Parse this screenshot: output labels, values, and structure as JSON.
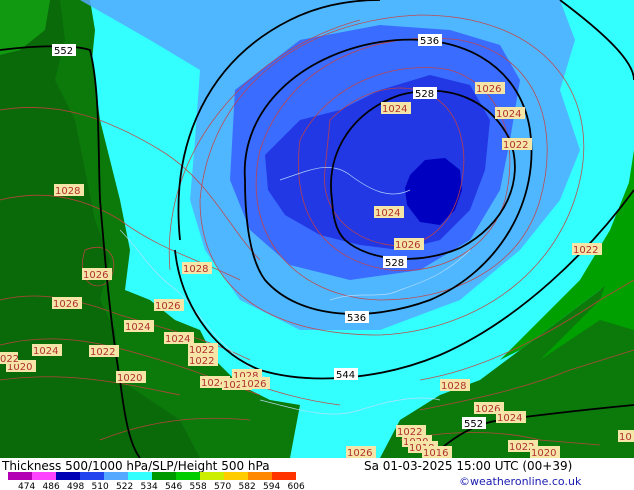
{
  "title": "Thickness 500/1000 hPa/SLP/Height 500 hPa",
  "valid_time": "Sa 01-03-2025 15:00 UTC (00+39)",
  "credit": "©weatheronline.co.uk",
  "colors": {
    "land": "#0b7a0b",
    "land_dark": "#0a5f0a",
    "green_band": "#00a000",
    "cyan": "#33ffff",
    "light_blue": "#55aaff",
    "mid_blue": "#3a6cff",
    "deep_blue": "#1f2fe0",
    "core": "#0000c0",
    "isobar_line": "#c84040",
    "height_line": "#000000",
    "label_bg": "#f5e6a8"
  },
  "scale": {
    "values": [
      "474",
      "486",
      "498",
      "510",
      "522",
      "534",
      "546",
      "558",
      "570",
      "582",
      "594",
      "606"
    ],
    "colors": [
      "#b400b4",
      "#ff44ff",
      "#0000b4",
      "#2244ee",
      "#55aaff",
      "#33ffff",
      "#009900",
      "#00cc00",
      "#ccee00",
      "#ffcc00",
      "#ff8800",
      "#ff3300"
    ]
  },
  "height_labels": {
    "h552_left": "552",
    "h536_top": "536",
    "h528_top": "528",
    "h528_bottom": "528",
    "h536_bottom": "536",
    "h544": "544",
    "h552_right": "552"
  },
  "pressure_labels": {
    "p1026_ne": "1026",
    "p1024_ne": "1024",
    "p1024_center_top": "1024",
    "p1022_ne": "1022",
    "p1024_center": "1024",
    "p1026_center": "1026",
    "p1022_east": "1022",
    "p1028_west": "1028",
    "p1026_west": "1026",
    "p1028_sw": "1028",
    "p1026_w2": "1026",
    "p1026_w3": "1026",
    "p1024_w": "1024",
    "p1024_w2": "1024",
    "p1024_w3": "1024",
    "p1022_w": "1022",
    "p1022_w2": "1022",
    "p1022_w3": "1022",
    "p1020_w": "1020",
    "p1020_w2": "1020",
    "p1022_edge": "022",
    "p1028_s": "1028",
    "p1024_s": "1024",
    "p1024_s2": "1024",
    "p1024_s3": "1026",
    "p1026_s": "1026",
    "p1028_se": "1028",
    "p1026_se": "1026",
    "p1024_se": "1024",
    "p1022_se": "1022",
    "p1020_se": "1020",
    "p1018_se": "1018",
    "p1016_se": "1016",
    "p1022_se2": "1022",
    "p1020_se2": "1020",
    "p1026_bottom": "1026",
    "p10_edge": "10"
  }
}
